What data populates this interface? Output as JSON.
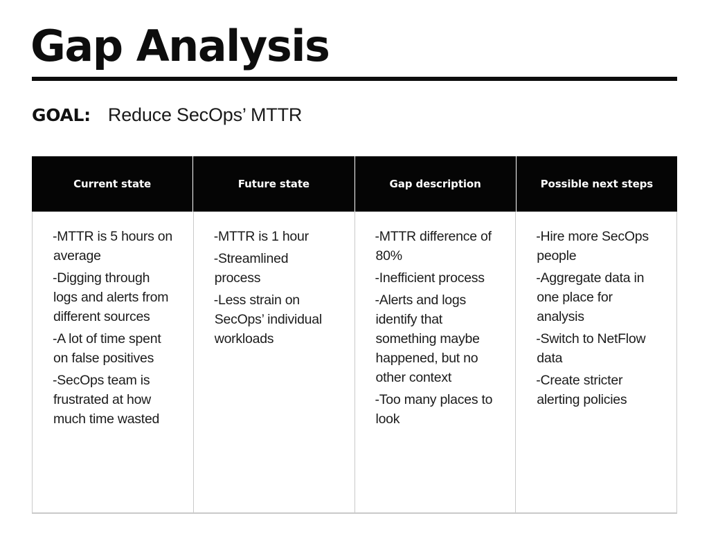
{
  "slide": {
    "title": "Gap Analysis",
    "goal": {
      "label": "GOAL:",
      "value": "Reduce SecOps’ MTTR"
    },
    "colors": {
      "header_background": "#050505",
      "header_text": "#ffffff",
      "body_text": "#1b1b1b",
      "rule": "#0d0d0d",
      "grid_line": "#c9c9c9",
      "page_background": "#ffffff"
    },
    "table": {
      "columns": [
        {
          "header": "Current state",
          "items": [
            "-MTTR is 5 hours on average",
            "-Digging through logs and alerts from different sources",
            "-A lot of time spent on false positives",
            "-SecOps team is frustrated at how much time wasted"
          ]
        },
        {
          "header": "Future state",
          "items": [
            "-MTTR is 1 hour",
            "-Streamlined process",
            "-Less strain on SecOps’ individual workloads"
          ]
        },
        {
          "header": "Gap description",
          "items": [
            "-MTTR difference of 80%",
            "-Inefficient process",
            "-Alerts and logs identify that something maybe happened, but no other context",
            "-Too many places to look"
          ]
        },
        {
          "header": "Possible next steps",
          "items": [
            "-Hire more SecOps people",
            "-Aggregate data in one place for analysis",
            "-Switch to NetFlow data",
            "-Create stricter alerting policies"
          ]
        }
      ]
    }
  }
}
